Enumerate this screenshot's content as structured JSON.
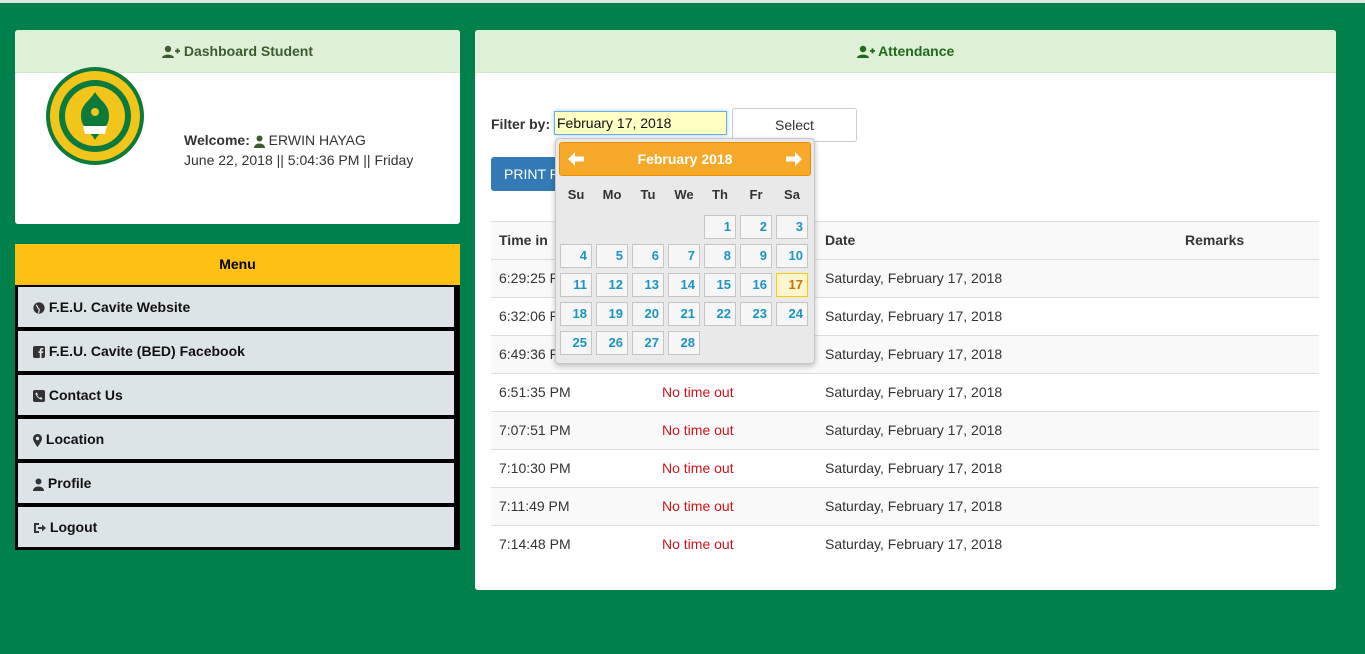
{
  "dashboard": {
    "title": "Dashboard Student",
    "welcome_label": "Welcome:",
    "user_name": "ERWIN HAYAG",
    "datetime": "June 22, 2018 || 5:04:36 PM || Friday"
  },
  "menu": {
    "title": "Menu",
    "items": [
      {
        "label": "F.E.U. Cavite Website",
        "icon": "globe-icon"
      },
      {
        "label": "F.E.U. Cavite (BED) Facebook",
        "icon": "facebook-icon"
      },
      {
        "label": "Contact Us",
        "icon": "phone-icon"
      },
      {
        "label": "Location",
        "icon": "map-marker-icon"
      },
      {
        "label": "Profile",
        "icon": "user-icon"
      },
      {
        "label": "Logout",
        "icon": "logout-icon"
      }
    ]
  },
  "attendance": {
    "title": "Attendance",
    "filter_label": "Filter by:",
    "filter_value": "February 17, 2018",
    "select_label": "Select",
    "print_label": "PRINT R",
    "columns": [
      "Time in",
      "",
      "Date",
      "Remarks"
    ],
    "rows": [
      {
        "time_in": "6:29:25 PM",
        "time_out": "",
        "date": "Saturday, February 17, 2018"
      },
      {
        "time_in": "6:32:06 PM",
        "time_out": "",
        "date": "Saturday, February 17, 2018"
      },
      {
        "time_in": "6:49:36 PM",
        "time_out": "",
        "date": "Saturday, February 17, 2018"
      },
      {
        "time_in": "6:51:35 PM",
        "time_out": "No time out",
        "date": "Saturday, February 17, 2018"
      },
      {
        "time_in": "7:07:51 PM",
        "time_out": "No time out",
        "date": "Saturday, February 17, 2018"
      },
      {
        "time_in": "7:10:30 PM",
        "time_out": "No time out",
        "date": "Saturday, February 17, 2018"
      },
      {
        "time_in": "7:11:49 PM",
        "time_out": "No time out",
        "date": "Saturday, February 17, 2018"
      },
      {
        "time_in": "7:14:48 PM",
        "time_out": "No time out",
        "date": "Saturday, February 17, 2018"
      }
    ]
  },
  "datepicker": {
    "month_label": "February 2018",
    "weekdays": [
      "Su",
      "Mo",
      "Tu",
      "We",
      "Th",
      "Fr",
      "Sa"
    ],
    "days": [
      "1",
      "2",
      "3",
      "4",
      "5",
      "6",
      "7",
      "8",
      "9",
      "10",
      "11",
      "12",
      "13",
      "14",
      "15",
      "16",
      "17",
      "18",
      "19",
      "20",
      "21",
      "22",
      "23",
      "24",
      "25",
      "26",
      "27",
      "28"
    ],
    "first_weekday_index": 4,
    "selected_day": "17"
  },
  "colors": {
    "background": "#00804a",
    "menu_header": "#fec012",
    "panel_header": "#dff0d8",
    "accent_orange": "#f6a828",
    "no_timeout_red": "#d0141a",
    "print_button": "#337ab7"
  }
}
